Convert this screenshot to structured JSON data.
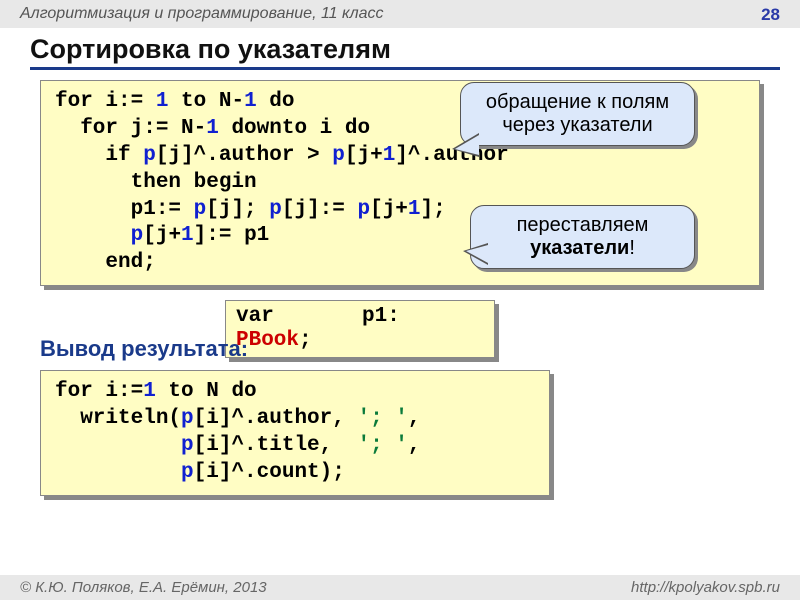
{
  "header": {
    "course": "Алгоритмизация и программирование, 11 класс",
    "page": "28"
  },
  "slide_title": "Сортировка по указателям",
  "code1": {
    "l1a": "for i:= ",
    "l1b": "1",
    "l1c": " to N-",
    "l1d": "1",
    "l1e": " do",
    "l2a": "  for j:= N-",
    "l2b": "1",
    "l2c": " downto i do",
    "l3a": "    if ",
    "l3b": "p",
    "l3c": "[j]^.author > ",
    "l3d": "p",
    "l3e": "[j+",
    "l3f": "1",
    "l3g": "]^.author",
    "l4a": "      then begin",
    "l5a": "      p1:= ",
    "l5b": "p",
    "l5c": "[j]; ",
    "l5d": "p",
    "l5e": "[j]:= ",
    "l5f": "p",
    "l5g": "[j+",
    "l5h": "1",
    "l5i": "];",
    "l6a": "      ",
    "l6b": "p",
    "l6c": "[j+",
    "l6d": "1",
    "l6e": "]:= p1",
    "l7a": "    end;"
  },
  "varbox": {
    "l1": "var       p1: ",
    "l2": "PBook",
    "l3": ";"
  },
  "bubble1": "обращение к полям через указатели",
  "bubble2_a": "переставляем ",
  "bubble2_b": "указатели",
  "bubble2_c": "!",
  "subhead": "Вывод результата:",
  "code2": {
    "l1a": "for i:=",
    "l1b": "1",
    "l1c": " to N do",
    "l2a": "  writeln(",
    "l2b": "p",
    "l2c": "[i]^.author, ",
    "l2d": "'; '",
    "l2e": ",",
    "l3a": "          ",
    "l3b": "p",
    "l3c": "[i]^.title,  ",
    "l3d": "'; '",
    "l3e": ",",
    "l4a": "          ",
    "l4b": "p",
    "l4c": "[i]^.count);"
  },
  "footer": {
    "left": "© К.Ю. Поляков, Е.А. Ерёмин, 2013",
    "right": "http://kpolyakov.spb.ru"
  }
}
